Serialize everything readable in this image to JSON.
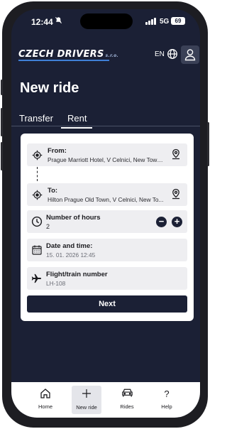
{
  "status_bar": {
    "time": "12:44",
    "network": "5G",
    "battery": "69"
  },
  "header": {
    "logo_text": "CZECH DRIVERS",
    "logo_sub": "s.r.o.",
    "language": "EN"
  },
  "page": {
    "title": "New ride"
  },
  "tabs": [
    {
      "label": "Transfer",
      "active": false
    },
    {
      "label": "Rent",
      "active": true
    }
  ],
  "form": {
    "from": {
      "label": "From:",
      "value": "Prague Marriott Hotel, V Celnici, New Town,..."
    },
    "to": {
      "label": "To:",
      "value": "Hilton Prague Old Town, V Celnici, New To..."
    },
    "hours": {
      "label": "Number of hours",
      "value": "2",
      "decrement": "−",
      "increment": "+"
    },
    "datetime": {
      "label": "Date and time:",
      "value": "15. 01. 2026 12:45"
    },
    "flight": {
      "label": "Flight/train number",
      "placeholder": "LH-108"
    },
    "next_label": "Next"
  },
  "bottom_nav": [
    {
      "label": "Home",
      "icon": "home-icon"
    },
    {
      "label": "New ride",
      "icon": "plus-icon",
      "active": true
    },
    {
      "label": "Rides",
      "icon": "car-icon"
    },
    {
      "label": "Help",
      "icon": "question-icon"
    }
  ],
  "colors": {
    "navy": "#1b2035",
    "field_bg": "#eeeef1",
    "logo_accent": "#3f7fd6"
  }
}
